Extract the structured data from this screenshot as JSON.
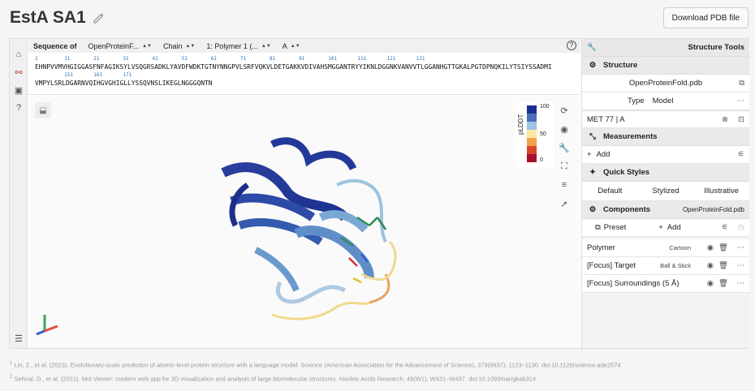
{
  "title": "EstA SA1",
  "download_label": "Download PDB file",
  "sequence_bar": {
    "label": "Sequence of",
    "source": "OpenProteinF...",
    "mode": "Chain",
    "polymer": "1: Polymer 1 (...",
    "chain": "A"
  },
  "sequence": {
    "line1_numbers": "1         11        21        31        41        51        61        71        81        91        101       111       121       131",
    "line1": "EHNPVVMVHGIGGASFNFAGIKSYLVSQGRSADKLYAVDFWDKTGTNYNNGPVLSRFVQKVLDETGAKKVDIVAHSMGGANTRYYIKNLDGGNKVANVVTLGGANHGTTGKALPGTDPNQKILYTSIYSSADMI",
    "line2_numbers": "          151       161       171",
    "line2": "VMPYLSRLDGARNVQIHGVGHIGLLYSSQVNSLIKEGLNGGGQNTN"
  },
  "legend": {
    "title": "pLDDT",
    "ticks": [
      "100",
      "50",
      "0"
    ],
    "colors": [
      "#1b2f8f",
      "#4a6fb8",
      "#9cc3df",
      "#fbe7a3",
      "#f0a24a",
      "#d9462b",
      "#a3112a"
    ]
  },
  "right_panel": {
    "header": "Structure Tools",
    "structure_section": "Structure",
    "file_name": "OpenProteinFold.pdb",
    "type_label": "Type",
    "type_value": "Model",
    "focus_residue": "MET 77 | A",
    "measurements_section": "Measurements",
    "add_label": "Add",
    "quick_styles_section": "Quick Styles",
    "quick_styles": [
      "Default",
      "Stylized",
      "Illustrative"
    ],
    "components_section": "Components",
    "components_source": "OpenProteinFold.pdb",
    "preset_label": "Preset",
    "components_add_label": "Add",
    "components": [
      {
        "name": "Polymer",
        "repr": "Cartoon"
      },
      {
        "name": "[Focus] Target",
        "repr": "Ball & Stick"
      },
      {
        "name": "[Focus] Surroundings (5 Å)",
        "repr": ""
      }
    ]
  },
  "references": [
    "Lin, Z., et al. (2023). Evolutionary-scale prediction of atomic-level protein structure with a language model. Science (American Association for the Advancement of Science), 379(6637), 1123–1130. doi:10.1126/science.ade2574",
    "Sehnal, D., et al. (2021). Mol Viewer: modern web app for 3D visualization and analysis of large biomolecular structures. Nucleic Acids Research, 49(W1), W431–W437. doi:10.1093/nar/gkab314"
  ],
  "reference_marks": [
    "1",
    "2"
  ]
}
